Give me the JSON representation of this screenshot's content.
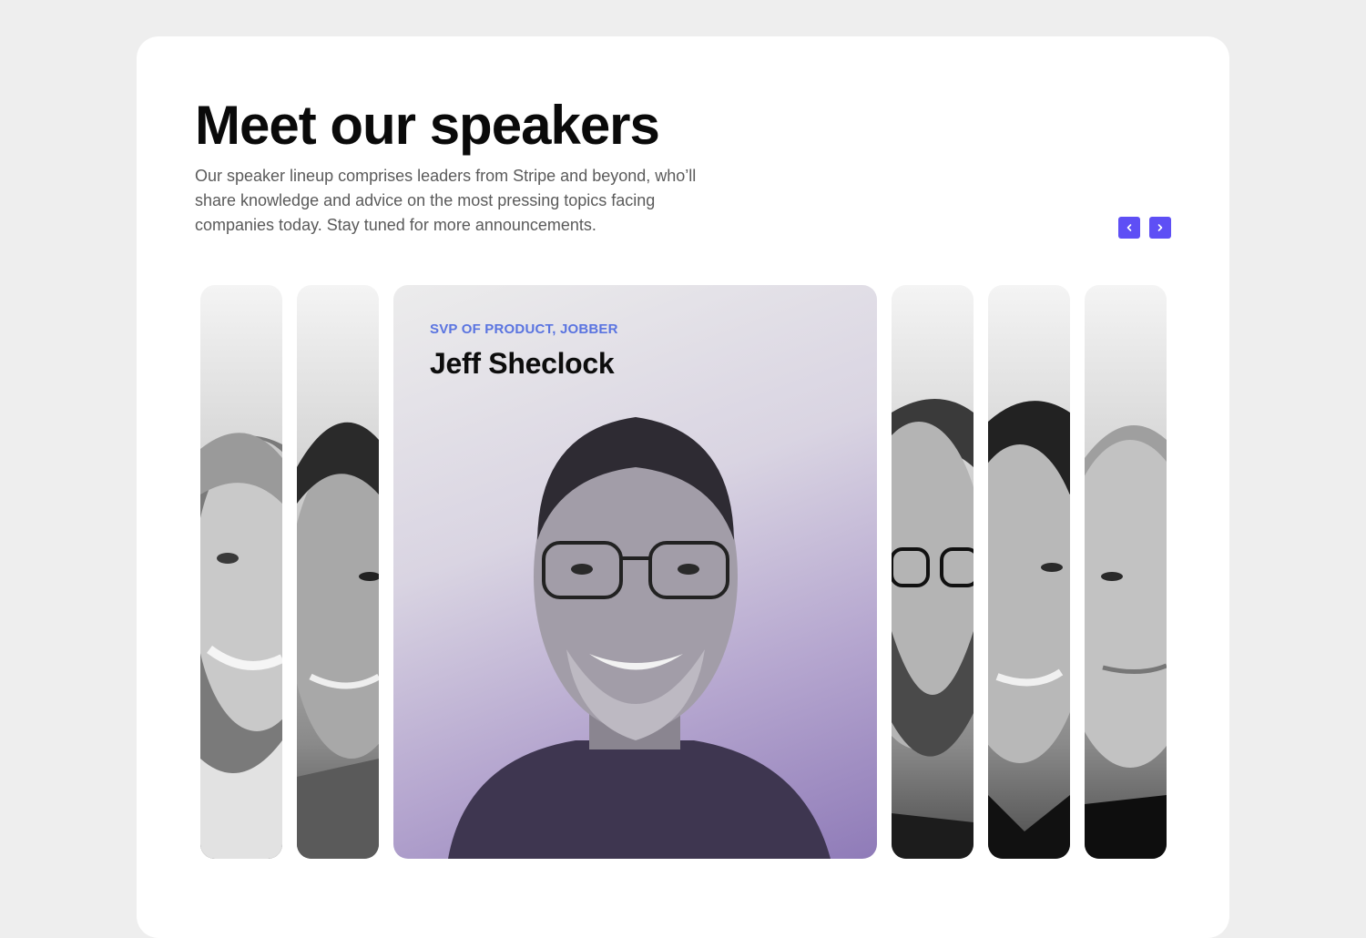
{
  "section": {
    "title": "Meet our speakers",
    "description": "Our speaker lineup comprises leaders from Stripe and beyond, who’ll share knowledge and advice on the most pressing topics facing companies today. Stay tuned for more announcements."
  },
  "carousel": {
    "prev_icon": "chevron-left-icon",
    "next_icon": "chevron-right-icon",
    "accent_color": "#5e4ff5",
    "featured": {
      "role": "SVP OF PRODUCT, JOBBER",
      "name": "Jeff Sheclock"
    }
  }
}
